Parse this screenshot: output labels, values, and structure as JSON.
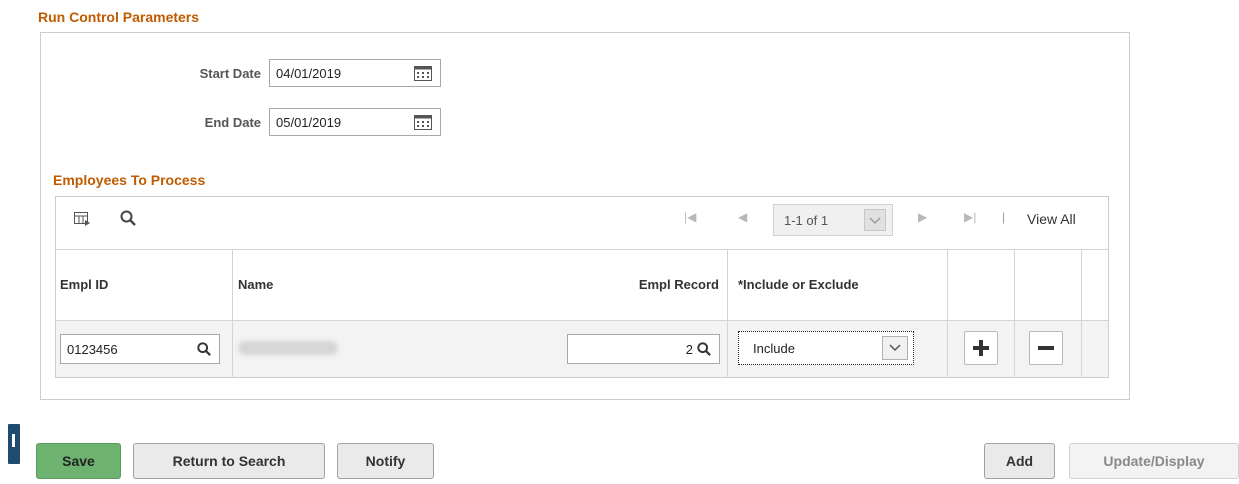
{
  "run_control": {
    "title": "Run Control Parameters",
    "start_date_label": "Start Date",
    "start_date_value": "04/01/2019",
    "end_date_label": "End Date",
    "end_date_value": "05/01/2019"
  },
  "employees": {
    "title": "Employees To Process",
    "pager_text": "1-1 of 1",
    "view_all": "View All",
    "columns": [
      "Empl ID",
      "Name",
      "Empl Record",
      "*Include or Exclude"
    ],
    "rows": [
      {
        "empl_id": "0123456",
        "name": "",
        "empl_record": "2",
        "include_exclude": "Include"
      }
    ]
  },
  "buttons": {
    "save": "Save",
    "return_to_search": "Return to Search",
    "notify": "Notify",
    "add": "Add",
    "update_display": "Update/Display"
  },
  "icons": [
    "calendar-icon",
    "personalize-icon",
    "search-icon",
    "first-page-icon",
    "prev-icon",
    "next-icon",
    "last-page-icon",
    "chevron-down-icon",
    "add-row-icon",
    "delete-row-icon"
  ],
  "colors": {
    "section_title": "#c05b00",
    "save_button": "#6db26e",
    "side_tab": "#1e4b6e"
  }
}
